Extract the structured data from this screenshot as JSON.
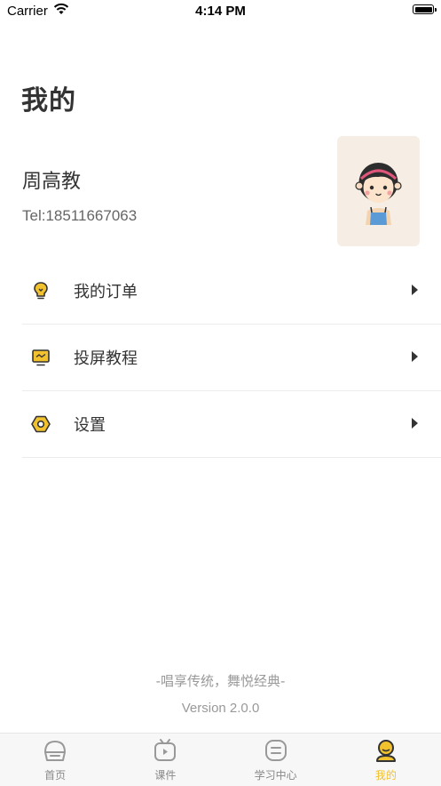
{
  "status_bar": {
    "carrier": "Carrier",
    "time": "4:14 PM"
  },
  "page": {
    "title": "我的"
  },
  "user": {
    "name": "周高教",
    "phone": "Tel:18511667063"
  },
  "menu": {
    "items": [
      {
        "label": "我的订单",
        "icon": "bulb-icon"
      },
      {
        "label": "投屏教程",
        "icon": "monitor-icon"
      },
      {
        "label": "设置",
        "icon": "hex-nut-icon"
      }
    ]
  },
  "footer": {
    "slogan": "-唱享传统，舞悦经典-",
    "version": "Version 2.0.0"
  },
  "tabs": [
    {
      "label": "首页",
      "icon": "home-icon"
    },
    {
      "label": "课件",
      "icon": "tv-icon"
    },
    {
      "label": "学习中心",
      "icon": "study-icon"
    },
    {
      "label": "我的",
      "icon": "profile-icon",
      "active": true
    }
  ],
  "colors": {
    "accent": "#f2c12e",
    "avatar_bg": "#f6eee4",
    "text": "#333333",
    "muted": "#999999"
  }
}
